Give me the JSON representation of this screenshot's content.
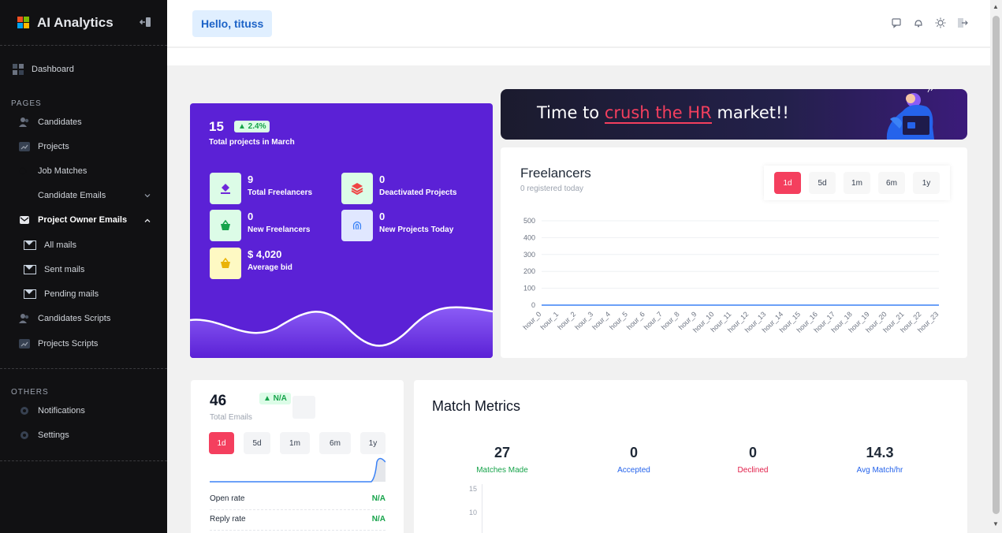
{
  "app": {
    "title": "AI Analytics",
    "colors": {
      "sidebar_bg": "#111113",
      "accent": "#f43f5e",
      "purple": "#5b21d6",
      "primary_blue": "#1d63c7",
      "green": "#16a34a"
    }
  },
  "sidebar": {
    "dashboard": "Dashboard",
    "pages_label": "PAGES",
    "items": [
      {
        "label": "Candidates",
        "icon": "users-icon"
      },
      {
        "label": "Projects",
        "icon": "chart-icon"
      },
      {
        "label": "Job Matches",
        "icon": "link-icon"
      },
      {
        "label": "Candidate Emails",
        "icon": "mail-icon",
        "chevron": "chevron-down-icon"
      },
      {
        "label": "Project Owner Emails",
        "icon": "mail-icon",
        "chevron": "chevron-up-icon"
      }
    ],
    "subitems": [
      {
        "label": "All mails",
        "icon": "envelope-icon"
      },
      {
        "label": "Sent mails",
        "icon": "envelope-icon"
      },
      {
        "label": "Pending mails",
        "icon": "envelope-icon"
      }
    ],
    "more_items": [
      {
        "label": "Candidates Scripts",
        "icon": "users-icon"
      },
      {
        "label": "Projects Scripts",
        "icon": "chart-icon"
      }
    ],
    "others_label": "OTHERS",
    "others": [
      {
        "label": "Notifications",
        "icon": "bell-icon"
      },
      {
        "label": "Settings",
        "icon": "gear-icon"
      }
    ]
  },
  "header": {
    "greeting": "Hello, tituss",
    "icons": [
      "chat-icon",
      "bell-icon",
      "sun-icon",
      "logout-icon"
    ]
  },
  "projects_card": {
    "total": "15",
    "change": "▲ 2.4%",
    "subtitle": "Total projects in March",
    "stats": [
      {
        "value": "9",
        "label": "Total Freelancers",
        "icon": "paint-bucket-icon"
      },
      {
        "value": "0",
        "label": "Deactivated Projects",
        "icon": "layers-icon"
      },
      {
        "value": "0",
        "label": "New Freelancers",
        "icon": "basket-icon"
      },
      {
        "value": "0",
        "label": "New Projects Today",
        "icon": "fingerprint-icon"
      },
      {
        "value": "$ 4,020",
        "label": "Average bid",
        "icon": "basket-icon"
      }
    ]
  },
  "banner": {
    "prefix": "Time to ",
    "highlight": "crush the HR",
    "suffix": " market!!"
  },
  "freelancers": {
    "title": "Freelancers",
    "subtitle": "0 registered today",
    "ranges": [
      "1d",
      "5d",
      "1m",
      "6m",
      "1y"
    ],
    "active_range": "1d"
  },
  "chart_data": {
    "type": "line",
    "title": "",
    "xlabel": "",
    "ylabel": "",
    "ylim": [
      0,
      500
    ],
    "y_ticks": [
      "500",
      "400",
      "300",
      "200",
      "100",
      "0"
    ],
    "categories": [
      "hour_0",
      "hour_1",
      "hour_2",
      "hour_3",
      "hour_4",
      "hour_5",
      "hour_6",
      "hour_7",
      "hour_8",
      "hour_9",
      "hour_10",
      "hour_11",
      "hour_12",
      "hour_13",
      "hour_14",
      "hour_15",
      "hour_16",
      "hour_17",
      "hour_18",
      "hour_19",
      "hour_20",
      "hour_21",
      "hour_22",
      "hour_23"
    ],
    "values": [
      0,
      0,
      0,
      0,
      0,
      0,
      0,
      0,
      0,
      0,
      0,
      0,
      0,
      0,
      0,
      0,
      0,
      0,
      0,
      0,
      0,
      0,
      0,
      0
    ],
    "grid": true,
    "line_color": "#3b82f6"
  },
  "emails": {
    "total": "46",
    "change": "▲ N/A",
    "label": "Total Emails",
    "ranges": [
      "1d",
      "5d",
      "1m",
      "6m",
      "1y"
    ],
    "active_range": "1d",
    "rows": [
      {
        "label": "Open rate",
        "value": "N/A"
      },
      {
        "label": "Reply rate",
        "value": "N/A"
      }
    ]
  },
  "match_metrics": {
    "title": "Match Metrics",
    "metrics": [
      {
        "value": "27",
        "label": "Matches Made",
        "color": "#16a34a"
      },
      {
        "value": "0",
        "label": "Accepted",
        "color": "#2563eb"
      },
      {
        "value": "0",
        "label": "Declined",
        "color": "#e11d48"
      },
      {
        "value": "14.3",
        "label": "Avg Match/hr",
        "color": "#2563eb"
      }
    ],
    "y_ticks": [
      "15",
      "10"
    ]
  }
}
